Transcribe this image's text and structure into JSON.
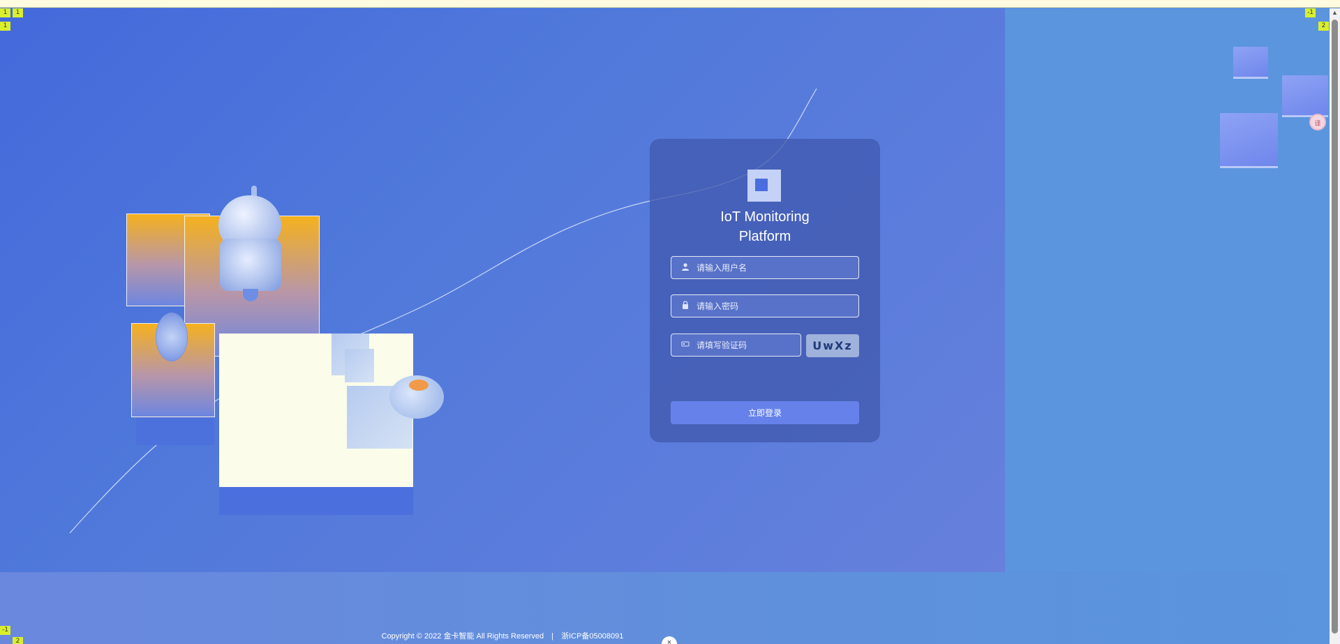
{
  "login": {
    "logo_icon": "square-logo-icon",
    "title_line1": "IoT Monitoring",
    "title_line2": "Platform",
    "username_placeholder": "请输入用户名",
    "password_placeholder": "请输入密码",
    "captcha_placeholder": "请填写验证码",
    "captcha_text": "UwXz",
    "submit_label": "立即登录",
    "icons": {
      "username": "user-icon",
      "password": "lock-icon",
      "captcha": "captcha-icon"
    }
  },
  "footer": {
    "copyright": "Copyright © 2022 金卡智能 All Rights Reserved",
    "separator": "|",
    "icp": "浙ICP备05008091"
  },
  "markers": {
    "top_left_a": "1",
    "top_left_b": "1",
    "top_right_a": "-1",
    "top_right_b": "2",
    "bottom_left_a": "-1",
    "bottom_left_b": "2"
  },
  "widgets": {
    "translate_label": "译",
    "close_label": "×"
  },
  "colors": {
    "primary": "#4a6ee0",
    "card": "#415aaf",
    "button": "#6682ea",
    "accent_orange": "#f5b11e"
  }
}
